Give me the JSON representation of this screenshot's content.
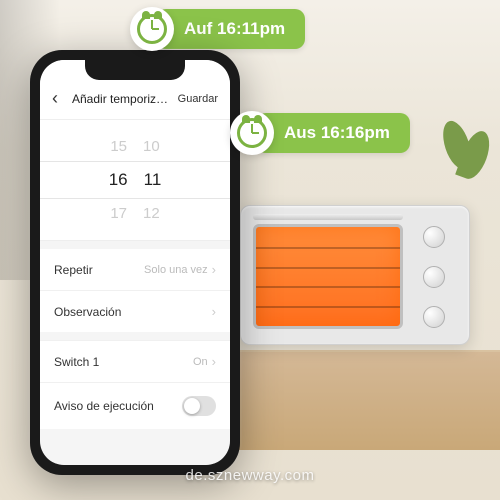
{
  "badges": {
    "on": "Auf 16:11pm",
    "off": "Aus 16:16pm"
  },
  "phone": {
    "nav": {
      "title": "Añadir temporización",
      "save": "Guardar"
    },
    "picker": {
      "prev_h": "15",
      "prev_m": "10",
      "sel_h": "16",
      "sel_m": "11",
      "next_h": "17",
      "next_m": "12"
    },
    "rows": {
      "repeat_label": "Repetir",
      "repeat_value": "Solo una vez",
      "note_label": "Observación",
      "switch_label": "Switch 1",
      "switch_value": "On",
      "exec_label": "Aviso de ejecución"
    }
  },
  "watermark": "de.sznewway.com"
}
